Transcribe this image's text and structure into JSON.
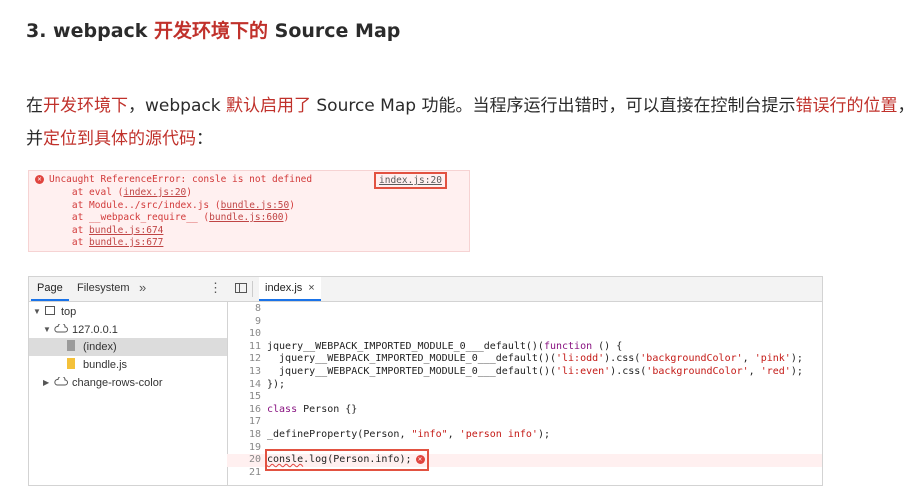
{
  "heading": {
    "prefix": "3. webpack ",
    "red": "开发环境下的",
    "suffix": " Source Map"
  },
  "paragraph": {
    "s1": "在",
    "s1_red": "开发环境下",
    "s2": "，webpack ",
    "s2_red": "默认启用了",
    "s3": " Source Map 功能。当程序运行出错时，可以直接在控制台提示",
    "s3_red": "错误行的位置",
    "s4": "，并",
    "s4_red": "定位到具体的源代码",
    "s5": "："
  },
  "console": {
    "error_message": "Uncaught ReferenceError: consle is not defined",
    "source_link": "index.js:20",
    "stack": [
      {
        "prefix": "    at eval (",
        "link": "index.js:20",
        "suffix": ")"
      },
      {
        "prefix": "    at Module../src/index.js (",
        "link": "bundle.js:50",
        "suffix": ")"
      },
      {
        "prefix": "    at __webpack_require__ (",
        "link": "bundle.js:600",
        "suffix": ")"
      },
      {
        "prefix": "    at ",
        "link": "bundle.js:674",
        "suffix": ""
      },
      {
        "prefix": "    at ",
        "link": "bundle.js:677",
        "suffix": ""
      }
    ]
  },
  "devtools": {
    "tabs": {
      "page": "Page",
      "filesystem": "Filesystem",
      "more": "»",
      "menu": "⋮"
    },
    "tree": {
      "top": "top",
      "host": "127.0.0.1",
      "index": "(index)",
      "bundle": "bundle.js",
      "folder": "change-rows-color"
    },
    "open_file": "index.js",
    "close": "×",
    "code": {
      "l8": "8",
      "l9": "9",
      "l10": "10",
      "l11": "11",
      "l12": "12",
      "l13": "13",
      "l14": "14",
      "l15": "15",
      "l16": "16",
      "l17": "17",
      "l18": "18",
      "l19": "19",
      "l20": "20",
      "l21": "21",
      "c11a": "jquery__WEBPACK_IMPORTED_MODULE_0___default()(",
      "c11b": "function",
      "c11c": " () {",
      "c12a": "  jquery__WEBPACK_IMPORTED_MODULE_0___default()(",
      "c12b": "'li:odd'",
      "c12c": ").css(",
      "c12d": "'backgroundColor'",
      "c12e": ", ",
      "c12f": "'pink'",
      "c12g": ");",
      "c13a": "  jquery__WEBPACK_IMPORTED_MODULE_0___default()(",
      "c13b": "'li:even'",
      "c13c": ").css(",
      "c13d": "'backgroundColor'",
      "c13e": ", ",
      "c13f": "'red'",
      "c13g": ");",
      "c14": "});",
      "c16a": "class",
      "c16b": " Person {}",
      "c18a": "_defineProperty(Person, ",
      "c18b": "\"info\"",
      "c18c": ", ",
      "c18d": "'person info'",
      "c18e": ");",
      "c20a": "consle",
      "c20b": ".log(Person.info);"
    }
  },
  "colors": {
    "accent_red": "#c0312b",
    "error_red": "#e0443e",
    "link_blue": "#1a73e8"
  }
}
